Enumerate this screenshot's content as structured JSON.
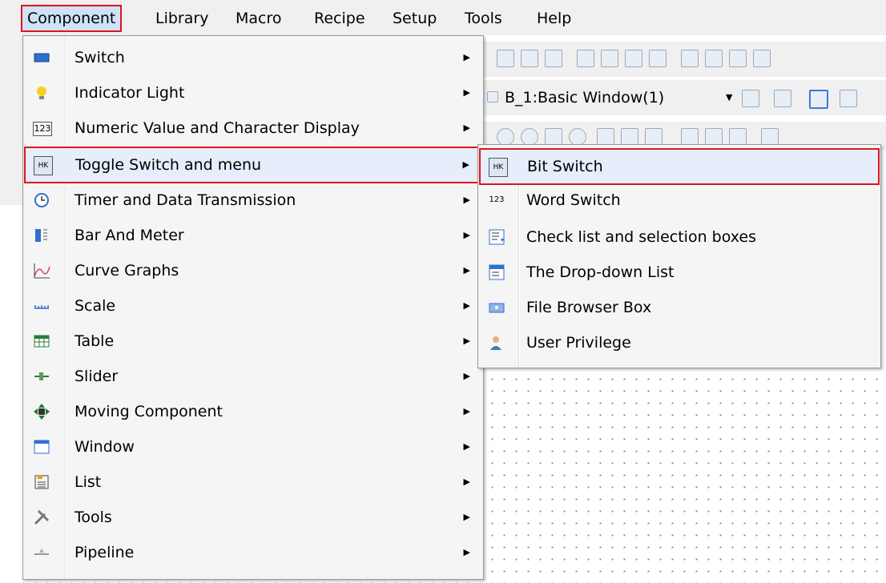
{
  "menubar": {
    "items": [
      "Component",
      "Library",
      "Macro",
      "Recipe",
      "Setup",
      "Tools",
      "Help"
    ]
  },
  "toolbar": {
    "window_select": "B_1:Basic Window(1)"
  },
  "component_menu": {
    "items": [
      {
        "label": "Switch",
        "icon": "switch-icon"
      },
      {
        "label": "Indicator Light",
        "icon": "lightbulb-icon"
      },
      {
        "label": "Numeric Value and Character Display",
        "icon": "numeric-123-icon"
      },
      {
        "label": "Toggle Switch and menu",
        "icon": "toggle-switch-icon"
      },
      {
        "label": "Timer and Data Transmission",
        "icon": "clock-icon"
      },
      {
        "label": "Bar And Meter",
        "icon": "bar-meter-icon"
      },
      {
        "label": "Curve Graphs",
        "icon": "curve-graph-icon"
      },
      {
        "label": "Scale",
        "icon": "scale-icon"
      },
      {
        "label": "Table",
        "icon": "table-icon"
      },
      {
        "label": "Slider",
        "icon": "slider-icon"
      },
      {
        "label": "Moving Component",
        "icon": "move-icon"
      },
      {
        "label": "Window",
        "icon": "window-icon"
      },
      {
        "label": "List",
        "icon": "list-icon"
      },
      {
        "label": "Tools",
        "icon": "tools-icon"
      },
      {
        "label": "Pipeline",
        "icon": "pipeline-icon"
      }
    ]
  },
  "submenu": {
    "items": [
      {
        "label": "Bit Switch",
        "icon": "bit-switch-icon"
      },
      {
        "label": "Word Switch",
        "icon": "word-switch-icon"
      },
      {
        "label": "Check list and selection boxes",
        "icon": "checklist-icon"
      },
      {
        "label": "The Drop-down List",
        "icon": "dropdown-list-icon"
      },
      {
        "label": "File Browser Box",
        "icon": "file-browser-icon"
      },
      {
        "label": "User Privilege",
        "icon": "user-privilege-icon"
      }
    ]
  },
  "colors": {
    "highlight_border": "#e0141e",
    "highlight_bg": "#e5eefa",
    "menu_bg": "#f5f5f5"
  }
}
